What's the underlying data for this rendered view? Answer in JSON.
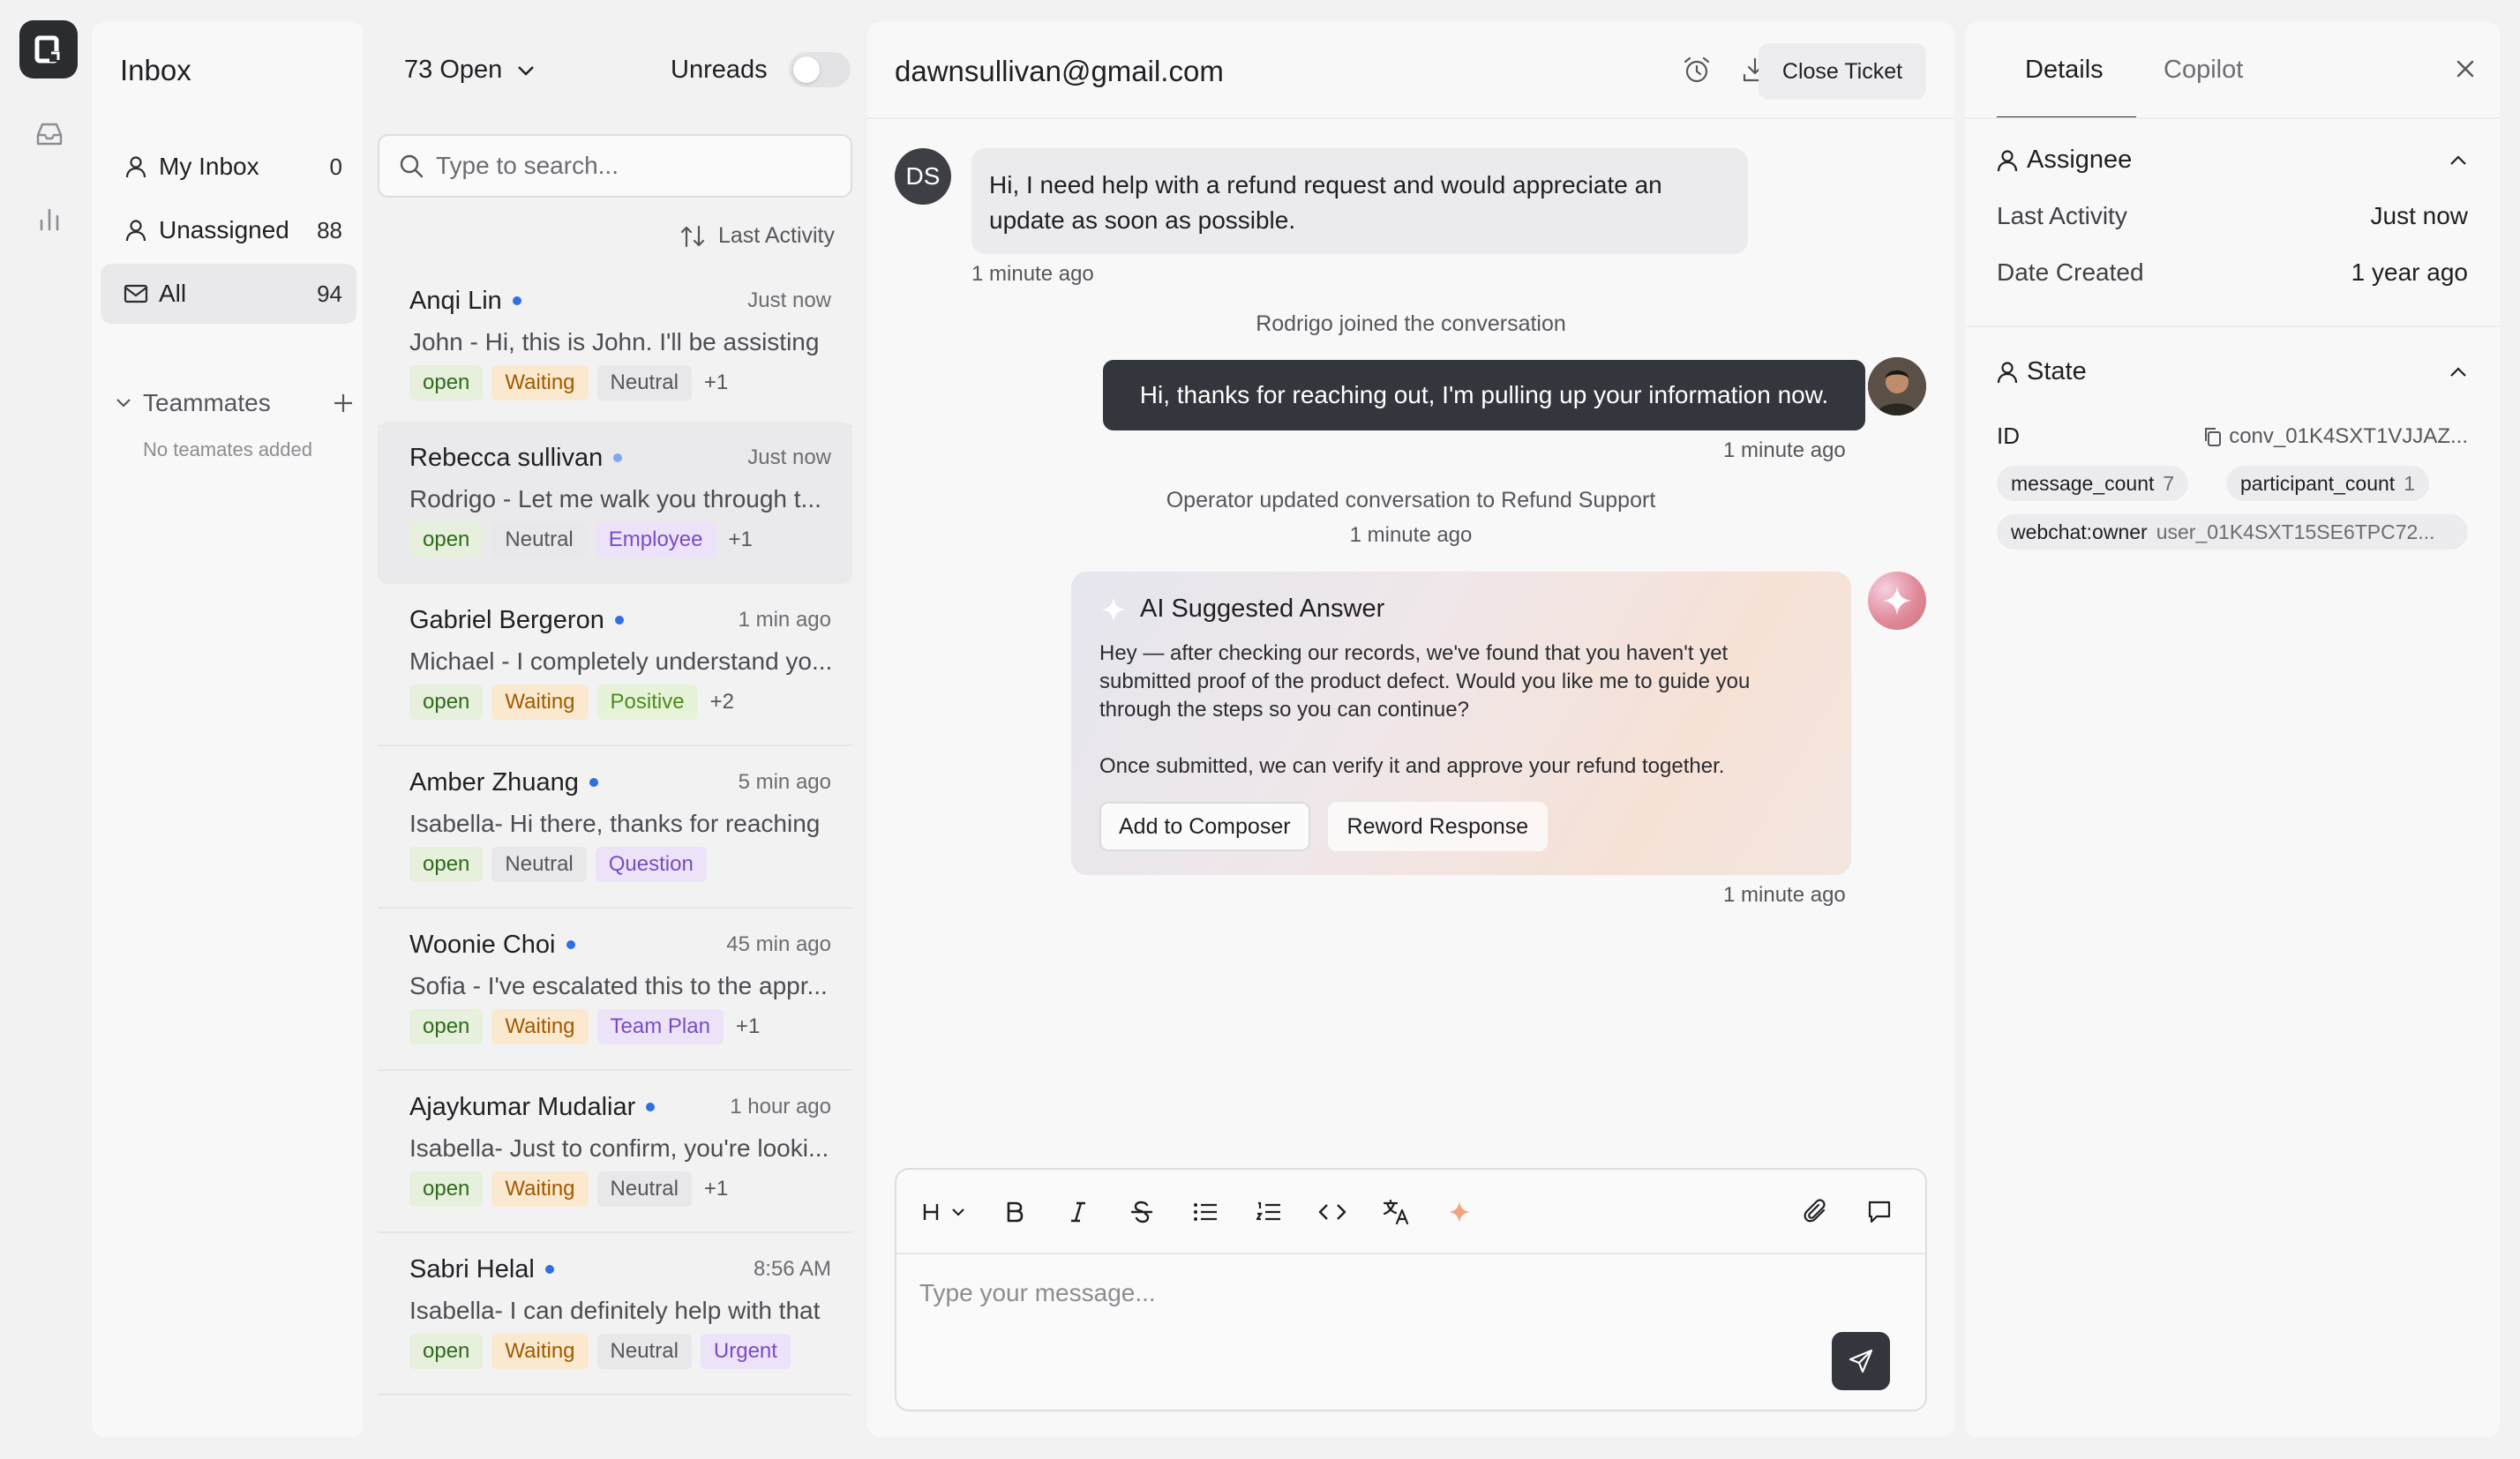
{
  "sidebar": {
    "title": "Inbox",
    "items": [
      {
        "label": "My Inbox",
        "count": "0",
        "icon": "user-icon"
      },
      {
        "label": "Unassigned",
        "count": "88",
        "icon": "user-icon"
      },
      {
        "label": "All",
        "count": "94",
        "icon": "mail-icon"
      }
    ],
    "teammates_label": "Teammates",
    "no_teammates": "No teamates added"
  },
  "list": {
    "filter_label": "73 Open",
    "unreads_label": "Unreads",
    "search_placeholder": "Type to search...",
    "sort_label": "Last Activity",
    "conversations": [
      {
        "name": "Anqi Lin",
        "time": "Just now",
        "preview": "John - Hi, this is John. I'll be assisting",
        "tags": [
          "open",
          "Waiting",
          "Neutral"
        ],
        "more": "+1"
      },
      {
        "name": "Rebecca sullivan",
        "time": "Just now",
        "preview": "Rodrigo - Let me walk you through t...",
        "tags": [
          "open",
          "Neutral",
          "Employee"
        ],
        "more": "+1"
      },
      {
        "name": "Gabriel Bergeron",
        "time": "1 min ago",
        "preview": "Michael - I completely understand yo...",
        "tags": [
          "open",
          "Waiting",
          "Positive"
        ],
        "more": "+2"
      },
      {
        "name": "Amber Zhuang",
        "time": "5 min ago",
        "preview": "Isabella- Hi there, thanks for reaching",
        "tags": [
          "open",
          "Neutral",
          "Question"
        ],
        "more": ""
      },
      {
        "name": "Woonie Choi",
        "time": "45 min ago",
        "preview": "Sofia - I've escalated this to the appr...",
        "tags": [
          "open",
          "Waiting",
          "Team Plan"
        ],
        "more": "+1"
      },
      {
        "name": "Ajaykumar Mudaliar",
        "time": "1 hour ago",
        "preview": "Isabella- Just to confirm, you're looki...",
        "tags": [
          "open",
          "Waiting",
          "Neutral"
        ],
        "more": "+1"
      },
      {
        "name": "Sabri Helal",
        "time": "8:56 AM",
        "preview": "Isabella- I can definitely help with that",
        "tags": [
          "open",
          "Waiting",
          "Neutral",
          "Urgent"
        ],
        "more": ""
      }
    ]
  },
  "chat": {
    "title": "dawnsullivan@gmail.com",
    "close_ticket": "Close Ticket",
    "customer_initials": "DS",
    "customer_message": "Hi, I need help with a refund request and would appreciate an update as soon as possible.",
    "customer_time": "1 minute ago",
    "system_joined": "Rodrigo joined the conversation",
    "agent_message": "Hi, thanks for reaching out, I'm pulling up your information now.",
    "agent_time": "1 minute ago",
    "system_updated": "Operator updated conversation to Refund Support",
    "system_updated_time": "1 minute ago",
    "ai": {
      "title": "AI Suggested Answer",
      "para1": "Hey — after checking our records, we've found that you haven't yet submitted proof of the product defect. Would you like me to guide you through the steps so you can continue?",
      "para2": "Once submitted, we can verify it and approve your refund together.",
      "add_button": "Add to Composer",
      "reword_button": "Reword Response",
      "time": "1 minute ago"
    },
    "composer_placeholder": "Type your message..."
  },
  "details": {
    "tabs": [
      "Details",
      "Copilot"
    ],
    "assignee_title": "Assignee",
    "last_activity_label": "Last Activity",
    "last_activity_value": "Just now",
    "date_created_label": "Date Created",
    "date_created_value": "1 year ago",
    "state_title": "State",
    "id_label": "ID",
    "id_value": "conv_01K4SXT1VJJAZ...",
    "chips": [
      {
        "key": "message_count",
        "value": "7"
      },
      {
        "key": "participant_count",
        "value": "1"
      },
      {
        "key": "webchat:owner",
        "value": "user_01K4SXT15SE6TPC72..."
      }
    ]
  },
  "colors": {
    "accent_dot": "#2f6fe0",
    "dark_bubble": "#33363c",
    "tag_open": "#2f6b1b",
    "tag_waiting": "#a05a00",
    "tag_purple": "#7a4cc2"
  }
}
